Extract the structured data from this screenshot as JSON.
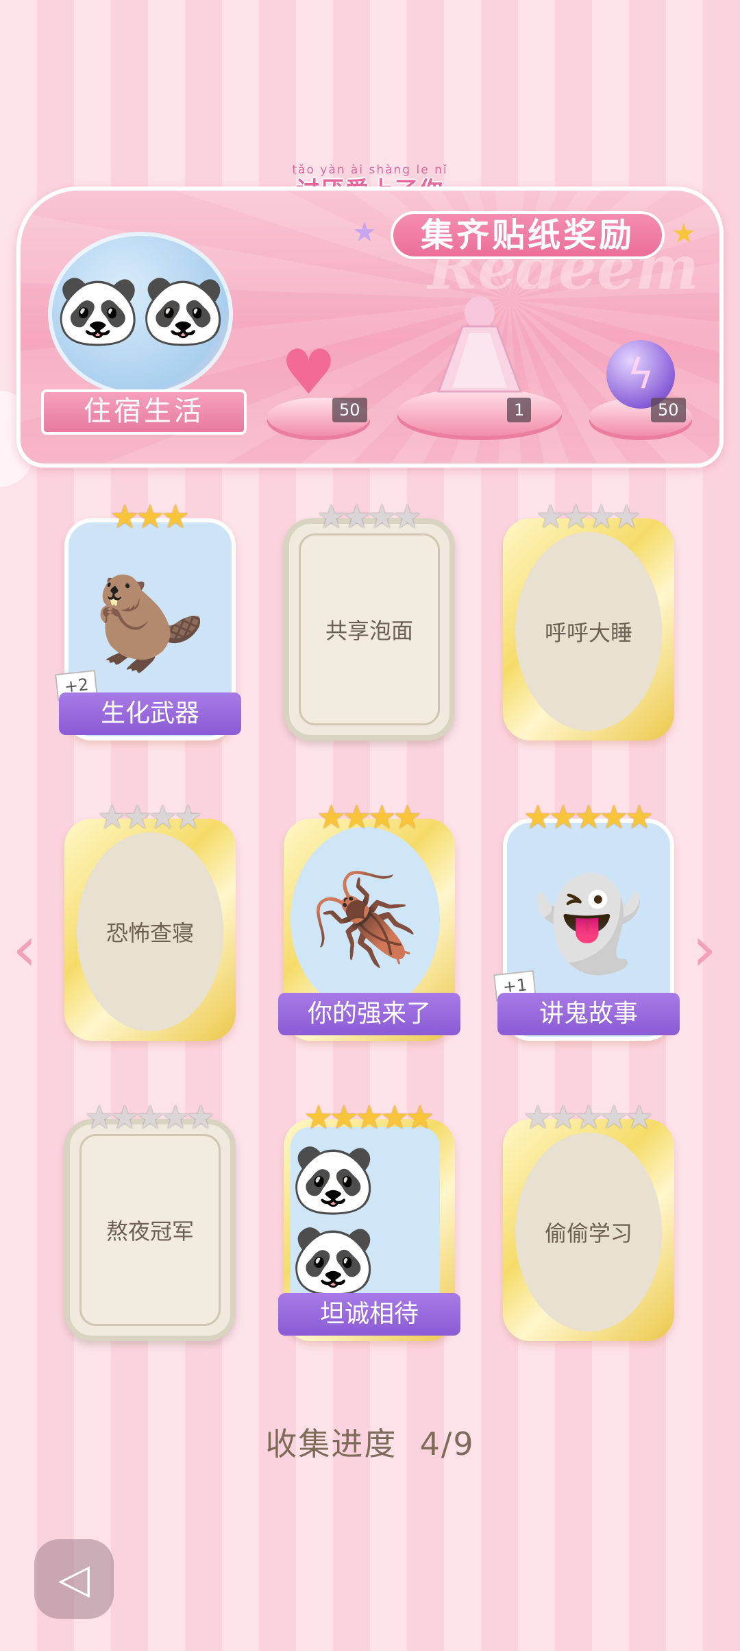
{
  "header": {
    "brand_pinyin": "tǎo yàn ài shàng le nǐ",
    "brand_title": "讨厌爱上了你"
  },
  "banner": {
    "title": "集齐贴纸奖励",
    "watermark": "Redeem",
    "theme_name": "住宿生活",
    "rewards": [
      {
        "icon": "pink-heart-gem-icon",
        "count": "50"
      },
      {
        "icon": "pink-gown-outfit-icon",
        "count": "1"
      },
      {
        "icon": "purple-energy-orb-icon",
        "count": "50"
      }
    ]
  },
  "cards": [
    {
      "name": "生化武器",
      "obtained": true,
      "stars": 3,
      "max_stars": 3,
      "art": "capybara-pajama-icon",
      "duplicate": "+2"
    },
    {
      "name": "共享泡面",
      "obtained": false,
      "stars": 0,
      "max_stars": 4,
      "frame": "silver"
    },
    {
      "name": "呼呼大睡",
      "obtained": false,
      "stars": 0,
      "max_stars": 4,
      "frame": "gold"
    },
    {
      "name": "恐怖查寝",
      "obtained": false,
      "stars": 0,
      "max_stars": 4,
      "frame": "gold"
    },
    {
      "name": "你的强来了",
      "obtained": true,
      "stars": 4,
      "max_stars": 4,
      "art": "cockroach-cute-icon"
    },
    {
      "name": "讲鬼故事",
      "obtained": true,
      "stars": 5,
      "max_stars": 5,
      "art": "ghost-costume-boy-icon",
      "duplicate": "+1"
    },
    {
      "name": "熬夜冠军",
      "obtained": false,
      "stars": 0,
      "max_stars": 5,
      "frame": "silver"
    },
    {
      "name": "坦诚相待",
      "obtained": true,
      "stars": 5,
      "max_stars": 5,
      "art": "pandas-bath-icon"
    },
    {
      "name": "偷偷学习",
      "obtained": false,
      "stars": 0,
      "max_stars": 5,
      "frame": "gold"
    }
  ],
  "progress": {
    "label": "收集进度",
    "value": "4/9"
  },
  "nav": {
    "prev_icon": "chevron-left-icon",
    "next_icon": "chevron-right-icon",
    "back_icon": "back-arrow-icon"
  },
  "colors": {
    "accent_pink": "#e5679c",
    "ribbon_purple": "#8b5bd4",
    "gold_frame": "#f5dc6a",
    "star_gold": "#f8c53a"
  }
}
